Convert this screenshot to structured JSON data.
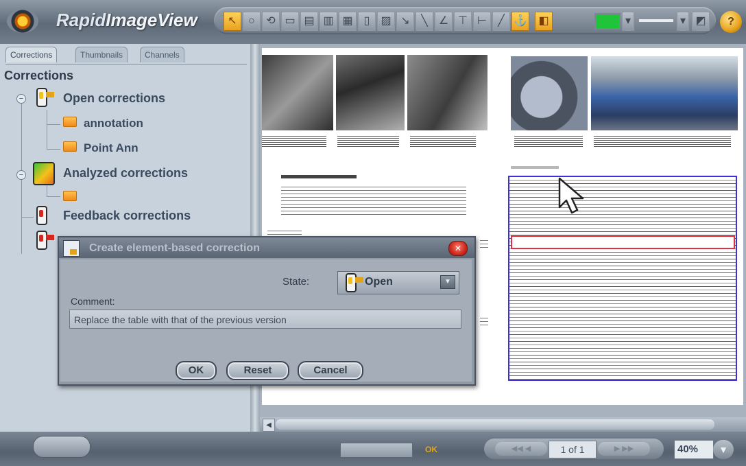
{
  "app": {
    "title_prefix": "Rapid",
    "title_suffix": "ImageView"
  },
  "left_panel": {
    "tabs": [
      "Corrections",
      "Thumbnails",
      "Channels"
    ],
    "active_tab": "Corrections",
    "heading": "Corrections",
    "tree": {
      "open": {
        "label": "Open corrections",
        "children": [
          "annotation",
          "Point Ann"
        ]
      },
      "analyzed": {
        "label": "Analyzed corrections"
      },
      "feedback": {
        "label": "Feedback corrections"
      }
    }
  },
  "dialog": {
    "title": "Create element-based correction",
    "state_label": "State:",
    "state_value": "Open",
    "comment_label": "Comment:",
    "comment_value": "Replace the table with that of the previous version",
    "ok_label": "OK",
    "reset_label": "Reset",
    "cancel_label": "Cancel"
  },
  "status_bar": {
    "ok_text": "OK",
    "page_indicator": "1 of 1",
    "zoom": "40%"
  },
  "colors": {
    "accent": "#e2a517",
    "selection_box": "#4030d8",
    "highlight_row": "#e03040",
    "status_green": "#1fc43a"
  }
}
